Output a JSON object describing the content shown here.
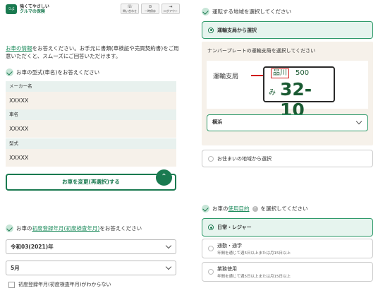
{
  "header": {
    "logo_line1": "強くてやさしい",
    "logo_line2": "クルマの保険",
    "logo_mark": "つよ",
    "buttons": [
      {
        "label": "問い合わせ",
        "icon": "phone-icon",
        "glyph": "☏"
      },
      {
        "label": "一時保存",
        "icon": "save-icon",
        "glyph": "⊙"
      },
      {
        "label": "ログアウト",
        "icon": "logout-icon",
        "glyph": "⇥"
      }
    ]
  },
  "intro": {
    "link": "お車の情報",
    "text": "をお答えください。お手元に書類(車検証や売買契約書)をご用意いただくと、スムーズにご回答いただけます。"
  },
  "car_model": {
    "question": "お車の型式(車名)をお答えください",
    "fields": [
      {
        "label": "メーカー名",
        "value": "XXXXX"
      },
      {
        "label": "車名",
        "value": "XXXXX"
      },
      {
        "label": "型式",
        "value": "XXXXX"
      }
    ],
    "change_button": "お車を変更(再選択)する",
    "fab_glyph": "⌃"
  },
  "registration": {
    "q_prefix": "お車の",
    "q_link": "初度登録年月(初度検査年月)",
    "q_suffix": "をお答えください",
    "year_value": "令和03(2021)年",
    "month_value": "5月",
    "unknown_label": "初度登録年月(初度検査年月)がわからない"
  },
  "region": {
    "question": "運転する地域を選択してください",
    "option_selected": "運輸支局から選択",
    "panel_title": "ナンバープレートの運輸支局を選択してください",
    "plate_label": "運輸支局",
    "plate": {
      "region": "品川",
      "class": "500",
      "kana": "み",
      "number": "32-10"
    },
    "office_select": "横浜",
    "option_other": "お住まいの地域から選択"
  },
  "usage": {
    "q_prefix": "お車の",
    "q_link": "使用目的",
    "q_suffix": "を選択してください",
    "help_glyph": "?",
    "options": [
      {
        "label": "日常・レジャー",
        "sub": ""
      },
      {
        "label": "通勤・通学",
        "sub": "年間を通じて週5日以上または月15日以上"
      },
      {
        "label": "業務使用",
        "sub": "年間を通じて週5日以上または月15日以上"
      }
    ]
  },
  "colors": {
    "accent": "#1a7a50",
    "highlight_bg": "#e6f4ee",
    "field_bg": "#f6f1ea",
    "label_bg": "#e8f1ee",
    "plate_red": "#d01818"
  }
}
